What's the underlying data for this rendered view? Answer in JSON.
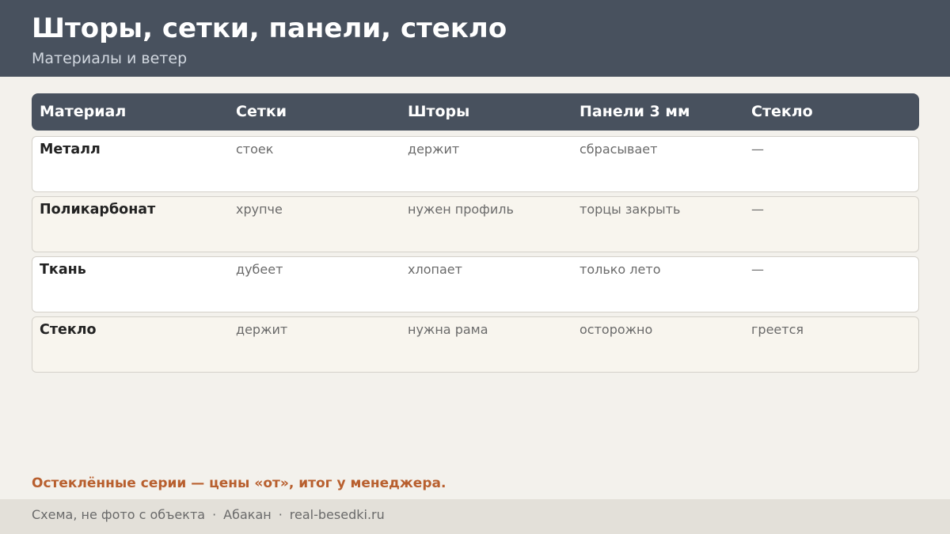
{
  "header": {
    "title": "Шторы, сетки, панели, стекло",
    "subtitle": "Материалы и ветер"
  },
  "table": {
    "columns": [
      "Материал",
      "Сетки",
      "Шторы",
      "Панели 3 мм",
      "Стекло"
    ],
    "rows": [
      [
        "Металл",
        "стоек",
        "держит",
        "сбрасывает",
        "—"
      ],
      [
        "Поликарбонат",
        "хрупче",
        "нужен профиль",
        "торцы закрыть",
        "—"
      ],
      [
        "Ткань",
        "дубеет",
        "хлопает",
        "только лето",
        "—"
      ],
      [
        "Стекло",
        "держит",
        "нужна рама",
        "осторожно",
        "греется"
      ]
    ]
  },
  "note": "Остеклённые серии — цены «от», итог у менеджера.",
  "footer": {
    "items": [
      "Схема, не фото с объекта",
      "Абакан",
      "real-besedki.ru"
    ],
    "separator": "·"
  },
  "colors": {
    "header_bg": "#48515e",
    "page_bg": "#f3f1ec",
    "accent": "#b85f2e",
    "footer_bg": "#e3e0d9"
  }
}
